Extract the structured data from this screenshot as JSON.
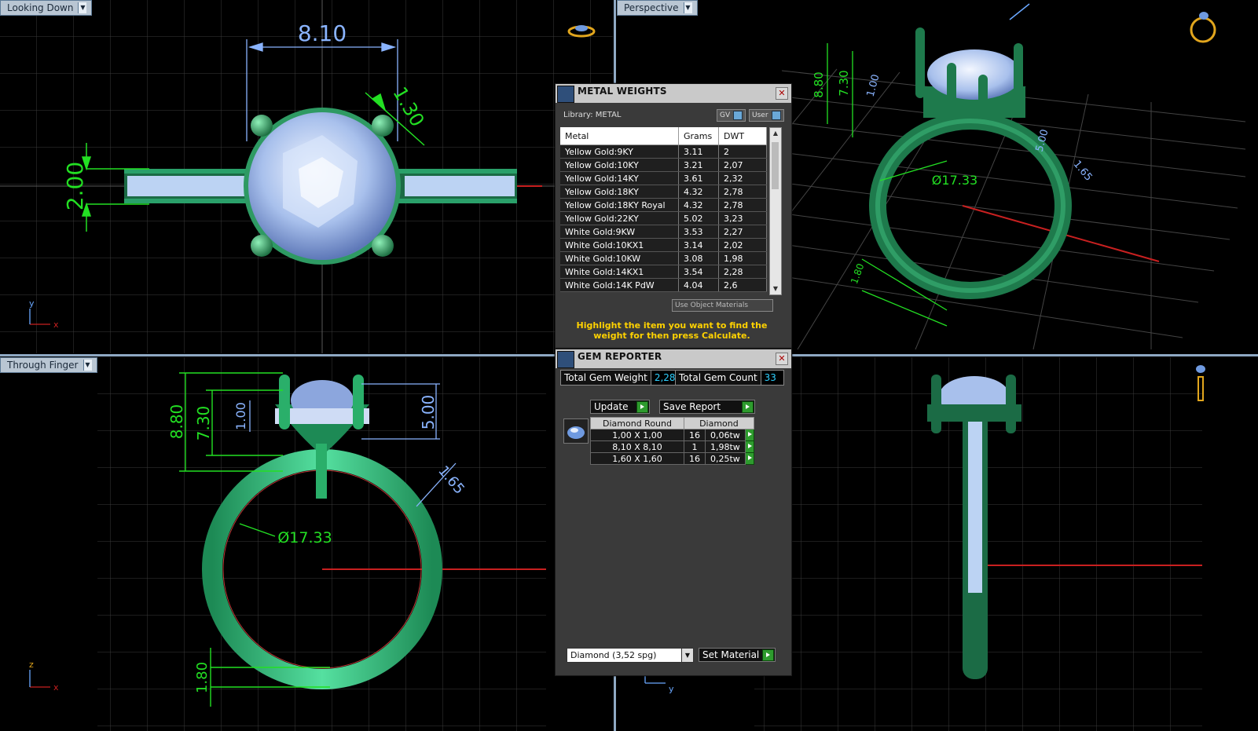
{
  "viewports": {
    "top_left": {
      "label": "Looking Down",
      "dims": [
        "8.10",
        "2.00",
        "1.30"
      ],
      "axes": [
        "y",
        "x"
      ]
    },
    "top_right": {
      "label": "Perspective",
      "dims": [
        "8.80",
        "7.30",
        "1.00",
        "5.00",
        "1.65",
        "Ø17.33",
        "1.80"
      ]
    },
    "bottom_left": {
      "label": "Through Finger",
      "dims": [
        "8.80",
        "7.30",
        "1.00",
        "5.00",
        "1.65",
        "Ø17.33",
        "1.80"
      ],
      "axes": [
        "z",
        "x"
      ]
    },
    "bottom_right": {
      "axes": [
        "y"
      ]
    }
  },
  "metal_weights": {
    "title": "METAL WEIGHTS",
    "library": "Library: METAL",
    "chip_gv": "GV",
    "chip_user": "User",
    "columns": [
      "Metal",
      "Grams",
      "DWT"
    ],
    "rows": [
      [
        "Yellow Gold:9KY",
        "3.11",
        "2"
      ],
      [
        "Yellow Gold:10KY",
        "3.21",
        "2,07"
      ],
      [
        "Yellow Gold:14KY",
        "3.61",
        "2,32"
      ],
      [
        "Yellow Gold:18KY",
        "4.32",
        "2,78"
      ],
      [
        "Yellow Gold:18KY Royal",
        "4.32",
        "2,78"
      ],
      [
        "Yellow Gold:22KY",
        "5.02",
        "3,23"
      ],
      [
        "White Gold:9KW",
        "3.53",
        "2,27"
      ],
      [
        "White Gold:10KX1",
        "3.14",
        "2,02"
      ],
      [
        "White Gold:10KW",
        "3.08",
        "1,98"
      ],
      [
        "White Gold:14KX1",
        "3.54",
        "2,28"
      ],
      [
        "White Gold:14K PdW",
        "4.04",
        "2,6"
      ]
    ],
    "use_object_materials": "Use Object Materials",
    "note": "Highlight the item you want to find the weight for then press Calculate."
  },
  "gem_reporter": {
    "title": "GEM REPORTER",
    "total_weight_label": "Total Gem Weight",
    "total_weight_value": "2,28",
    "total_count_label": "Total Gem Count",
    "total_count_value": "33",
    "update_label": "Update",
    "save_report_label": "Save Report",
    "columns": [
      "Diamond Round",
      "Diamond"
    ],
    "rows": [
      [
        "1,00 X 1,00",
        "16",
        "0,06tw"
      ],
      [
        "8,10 X 8,10",
        "1",
        "1,98tw"
      ],
      [
        "1,60 X 1,60",
        "16",
        "0,25tw"
      ]
    ],
    "material_select": "Diamond     (3,52 spg)",
    "set_material_label": "Set Material"
  },
  "colors": {
    "dim_green": "#23e023",
    "dim_blue": "#8ab4ff",
    "ring_green": "#1f8a55",
    "gem": "#a9c4f0",
    "grid": "#3a3a3a"
  }
}
